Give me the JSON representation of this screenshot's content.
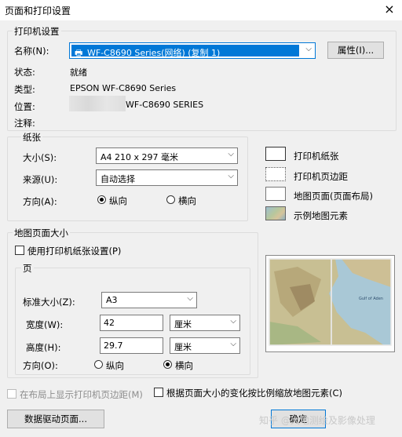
{
  "window": {
    "title": "页面和打印设置",
    "close": "×"
  },
  "printer": {
    "group_title": "打印机设置",
    "name_label": "名称(N):",
    "name_value": "WF-C8690 Series(网络) (复制 1)",
    "properties_button": "属性(I)...",
    "status_label": "状态:",
    "status_value": "就绪",
    "type_label": "类型:",
    "type_value": "EPSON WF-C8690 Series",
    "location_label": "位置:",
    "location_value": "WF-C8690 SERIES",
    "comment_label": "注释:"
  },
  "paper": {
    "group_title": "纸张",
    "size_label": "大小(S):",
    "size_value": "A4 210 x 297 毫米",
    "source_label": "来源(U):",
    "source_value": "自动选择",
    "orientation_label": "方向(A):",
    "portrait": "纵向",
    "landscape": "横向",
    "selected": "portrait"
  },
  "legend": [
    {
      "label": "打印机纸张",
      "icon": "printer-paper-swatch"
    },
    {
      "label": "打印机页边距",
      "icon": "printer-margins-swatch"
    },
    {
      "label": "地图页面(页面布局)",
      "icon": "map-page-swatch"
    },
    {
      "label": "示例地图元素",
      "icon": "sample-map-element-swatch"
    }
  ],
  "map_page": {
    "group_title": "地图页面大小",
    "use_printer_paper": "使用打印机纸张设置(P)",
    "page_group_title": "页",
    "standard_size_label": "标准大小(Z):",
    "standard_size_value": "A3",
    "width_label": "宽度(W):",
    "width_value": "42",
    "height_label": "高度(H):",
    "height_value": "29.7",
    "unit_value": "厘米",
    "orientation_label": "方向(O):",
    "portrait": "纵向",
    "landscape": "横向",
    "selected": "landscape"
  },
  "preview_map_texts": [
    "Gulf of Aden"
  ],
  "footer": {
    "show_margins": "在布局上显示打印机页边距(M)",
    "scale_elements": "根据页面大小的变化按比例缩放地图元素(C)",
    "data_driven_button": "数据驱动页面...",
    "ok_button": "确定",
    "watermark": "知乎 @大地测绘及影像处理"
  }
}
